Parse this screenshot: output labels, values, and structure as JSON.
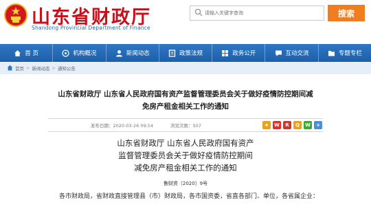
{
  "header": {
    "title": "山东省财政厅",
    "subtitle": "Shandong Provincial Department of Finance",
    "search_placeholder": "请输入关键字查询",
    "search_button": "搜索"
  },
  "nav": {
    "items": [
      {
        "label": "首 页",
        "icon": "home-icon"
      },
      {
        "label": "机构概况",
        "icon": "building-icon"
      },
      {
        "label": "新闻动态",
        "icon": "user-icon"
      },
      {
        "label": "政策法规",
        "icon": "book-icon"
      },
      {
        "label": "政务公开",
        "icon": "grid-icon"
      },
      {
        "label": "互动交流",
        "icon": "chat-icon"
      },
      {
        "label": "专题专栏",
        "icon": "folder-icon"
      }
    ]
  },
  "breadcrumb": {
    "items": [
      "首页",
      "新闻动态",
      "通知公告"
    ],
    "separator": ">"
  },
  "article": {
    "title_line1": "山东省财政厅 山东省人民政府国有资产监督管理委员会关于做好疫情防控期间减",
    "title_line2": "免房产租金相关工作的通知",
    "date_label": "发布日期：2020-03-26 09:54",
    "views_label": "浏览次数：507",
    "heading_line1": "山东省财政厅 山东省人民政府国有资产",
    "heading_line2": "监督管理委员会关于做好疫情防控期间",
    "heading_line3": "减免房产租金相关工作的通知",
    "doc_number": "鲁财资〔2020〕9号",
    "body": "各市财政局，省财政直接管理县（市）财政局，各市国资委，省直各部门、单位，各省属企业："
  },
  "colors": {
    "brand_red": "#c8101a",
    "nav_blue": "#1d5fa9",
    "search_orange": "#f27d1f"
  }
}
